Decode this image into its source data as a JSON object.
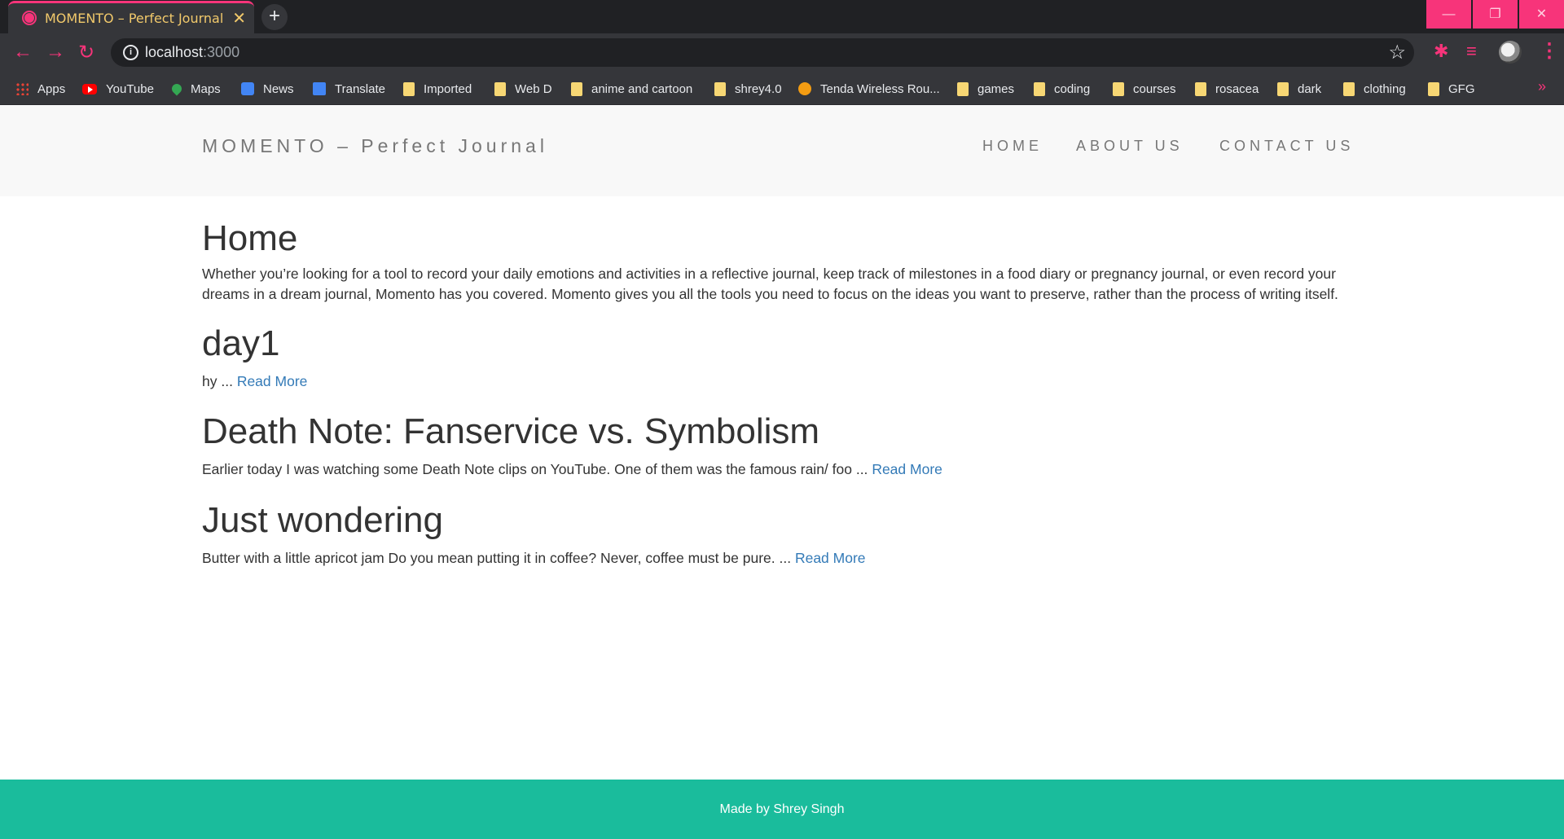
{
  "browser": {
    "tab_title": "MOMENTO – Perfect Journal",
    "tab_close": "✕",
    "new_tab": "+",
    "url_host": "localhost",
    "url_port": ":3000",
    "window_controls": {
      "minimize": "—",
      "restore": "❐",
      "close": "✕"
    },
    "accent_color": "#f7347a",
    "bookmarks": [
      {
        "label": "Apps",
        "icon": "apps-grid-icon"
      },
      {
        "label": "YouTube",
        "icon": "youtube-icon"
      },
      {
        "label": "Maps",
        "icon": "maps-icon"
      },
      {
        "label": "News",
        "icon": "google-news-icon"
      },
      {
        "label": "Translate",
        "icon": "google-translate-icon"
      },
      {
        "label": "Imported",
        "icon": "folder-icon"
      },
      {
        "label": "Web D",
        "icon": "folder-icon"
      },
      {
        "label": "anime and cartoon",
        "icon": "folder-icon"
      },
      {
        "label": "shrey4.0",
        "icon": "folder-icon"
      },
      {
        "label": "Tenda Wireless Rou...",
        "icon": "tenda-icon"
      },
      {
        "label": "games",
        "icon": "folder-icon"
      },
      {
        "label": "coding",
        "icon": "folder-icon"
      },
      {
        "label": "courses",
        "icon": "folder-icon"
      },
      {
        "label": "rosacea",
        "icon": "folder-icon"
      },
      {
        "label": "dark",
        "icon": "folder-icon"
      },
      {
        "label": "clothing",
        "icon": "folder-icon"
      },
      {
        "label": "GFG",
        "icon": "folder-icon"
      }
    ],
    "bookmarks_overflow": "»"
  },
  "site": {
    "brand": "MOMENTO – Perfect Journal",
    "nav": [
      "HOME",
      "ABOUT US",
      "CONTACT US"
    ],
    "page_title": "Home",
    "intro": "Whether you’re looking for a tool to record your daily emotions and activities in a reflective journal, keep track of milestones in a food diary or pregnancy journal, or even record your dreams in a dream journal, Momento has you covered. Momento gives you all the tools you need to focus on the ideas you want to preserve, rather than the process of writing itself.",
    "posts": [
      {
        "title": "day1",
        "excerpt": "hy ...",
        "link": "Read More"
      },
      {
        "title": "Death Note: Fanservice vs. Symbolism",
        "excerpt": "Earlier today I was watching some Death Note clips on YouTube. One of them was the famous rain/ foo ...",
        "link": "Read More"
      },
      {
        "title": "Just wondering",
        "excerpt": "Butter with a little apricot jam Do you mean putting it in coffee? Never, coffee must be pure. ...",
        "link": "Read More"
      }
    ],
    "footer": "Made by Shrey Singh",
    "footer_color": "#1abc9c",
    "link_color": "#337ab7"
  }
}
